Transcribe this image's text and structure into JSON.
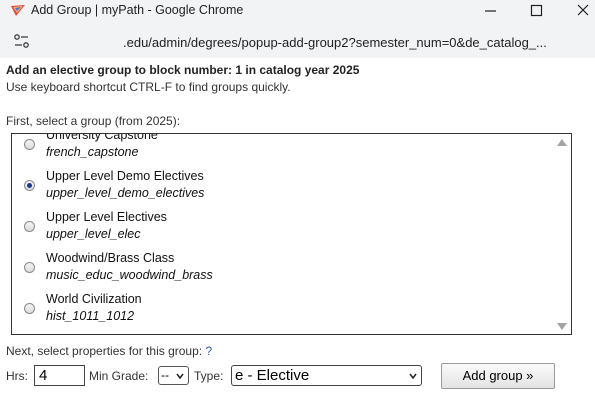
{
  "window": {
    "title": "Add Group | myPath - Google Chrome",
    "url": ".edu/admin/degrees/popup-add-group2?semester_num=0&de_catalog_..."
  },
  "page": {
    "heading": "Add an elective group to block number: 1 in catalog year 2025",
    "hint": "Use keyboard shortcut CTRL-F to find groups quickly.",
    "select_prompt": "First, select a group (from 2025):",
    "groups": [
      {
        "title": "University Capstone",
        "code": "french_capstone",
        "selected": false
      },
      {
        "title": "Upper Level Demo Electives",
        "code": "upper_level_demo_electives",
        "selected": true
      },
      {
        "title": "Upper Level Electives",
        "code": "upper_level_elec",
        "selected": false
      },
      {
        "title": "Woodwind/Brass Class",
        "code": "music_educ_woodwind_brass",
        "selected": false
      },
      {
        "title": "World Civilization",
        "code": "hist_1011_1012",
        "selected": false
      }
    ],
    "props_label": "Next, select properties for this group:",
    "help_link": "?"
  },
  "form": {
    "hrs_label": "Hrs:",
    "hrs_value": "4",
    "min_grade_label": "Min Grade:",
    "min_grade_value": "--",
    "type_label": "Type:",
    "type_value": "e - Elective",
    "add_button": "Add group »"
  },
  "colors": {
    "chrome_bg": "#f1f3f4",
    "link": "#2a5db0",
    "radio_checked": "#1a3a8a"
  }
}
